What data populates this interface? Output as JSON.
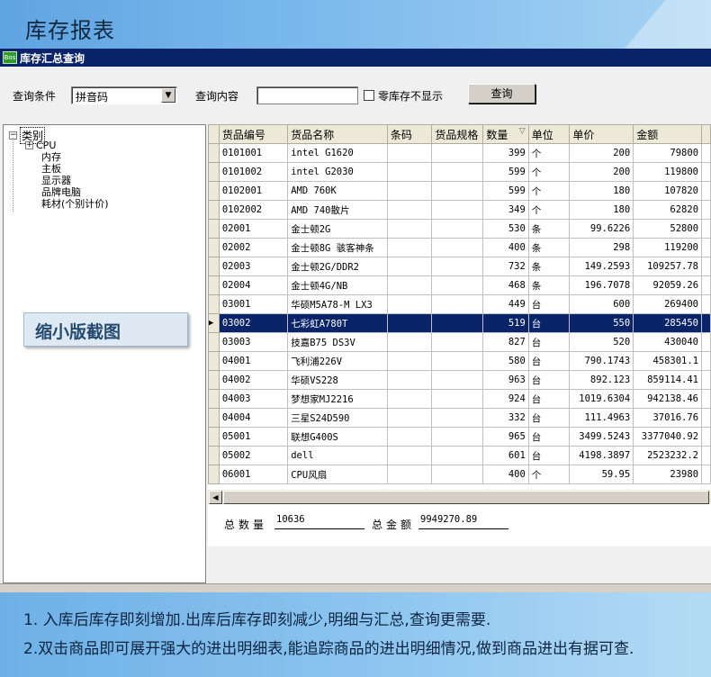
{
  "banner": {
    "title": "库存报表"
  },
  "window": {
    "title": "库存汇总查询",
    "icon_text": "Bos"
  },
  "query": {
    "condition_label": "查询条件",
    "condition_value": "拼音码",
    "content_label": "查询内容",
    "content_value": "",
    "zero_stock_label": "零库存不显示",
    "zero_stock_checked": false,
    "search_button": "查询"
  },
  "tree": {
    "root": "类别",
    "items": [
      "CPU",
      "内存",
      "主板",
      "显示器",
      "品牌电脑",
      "耗材(个别计价)"
    ]
  },
  "overlay_label": "缩小版截图",
  "grid": {
    "columns": [
      "货品编号",
      "货品名称",
      "条码",
      "货品规格",
      "数量",
      "单位",
      "单价",
      "金额"
    ],
    "rows": [
      [
        "0101001",
        "intel G1620",
        "",
        "",
        "399",
        "个",
        "200",
        "79800"
      ],
      [
        "0101002",
        "intel G2030",
        "",
        "",
        "599",
        "个",
        "200",
        "119800"
      ],
      [
        "0102001",
        "AMD 760K",
        "",
        "",
        "599",
        "个",
        "180",
        "107820"
      ],
      [
        "0102002",
        "AMD 740散片",
        "",
        "",
        "349",
        "个",
        "180",
        "62820"
      ],
      [
        "02001",
        "金士顿2G",
        "",
        "",
        "530",
        "条",
        "99.6226",
        "52800"
      ],
      [
        "02002",
        "金士顿8G 骇客神条",
        "",
        "",
        "400",
        "条",
        "298",
        "119200"
      ],
      [
        "02003",
        "金士顿2G/DDR2",
        "",
        "",
        "732",
        "条",
        "149.2593",
        "109257.78"
      ],
      [
        "02004",
        "金士顿4G/NB",
        "",
        "",
        "468",
        "条",
        "196.7078",
        "92059.26"
      ],
      [
        "03001",
        "华硕M5A78-M LX3",
        "",
        "",
        "449",
        "台",
        "600",
        "269400"
      ],
      [
        "03002",
        "七彩虹A780T",
        "",
        "",
        "519",
        "台",
        "550",
        "285450"
      ],
      [
        "03003",
        "技嘉B75 DS3V",
        "",
        "",
        "827",
        "台",
        "520",
        "430040"
      ],
      [
        "04001",
        "飞利浦226V",
        "",
        "",
        "580",
        "台",
        "790.1743",
        "458301.1"
      ],
      [
        "04002",
        "华硕VS228",
        "",
        "",
        "963",
        "台",
        "892.123",
        "859114.41"
      ],
      [
        "04003",
        " 梦想家MJ2216",
        "",
        "",
        "924",
        "台",
        "1019.6304",
        "942138.46"
      ],
      [
        "04004",
        "三星S24D590",
        "",
        "",
        "332",
        "台",
        "111.4963",
        "37016.76"
      ],
      [
        "05001",
        "联想G400S",
        "",
        "",
        "965",
        "台",
        "3499.5243",
        "3377040.92"
      ],
      [
        "05002",
        "dell",
        "",
        "",
        "601",
        "台",
        "4198.3897",
        "2523232.2"
      ],
      [
        "06001",
        "CPU风扇",
        "",
        "",
        "400",
        "个",
        "59.95",
        "23980"
      ]
    ],
    "selected_row_index": 9
  },
  "summary": {
    "qty_label": "总数量",
    "qty_value": "10636",
    "amount_label": "总金额",
    "amount_value": "9949270.89"
  },
  "footer": {
    "line1": "1. 入库后库存即刻增加.出库后库存即刻减少,明细与汇总,查询更需要.",
    "line2": "2.双击商品即可展开强大的进出明细表,能追踪商品的进出明细情况,做到商品进出有据可查."
  },
  "colors": {
    "selection": "#0a246a",
    "titlebar": "#0a246a",
    "banner": "#7fbced"
  }
}
